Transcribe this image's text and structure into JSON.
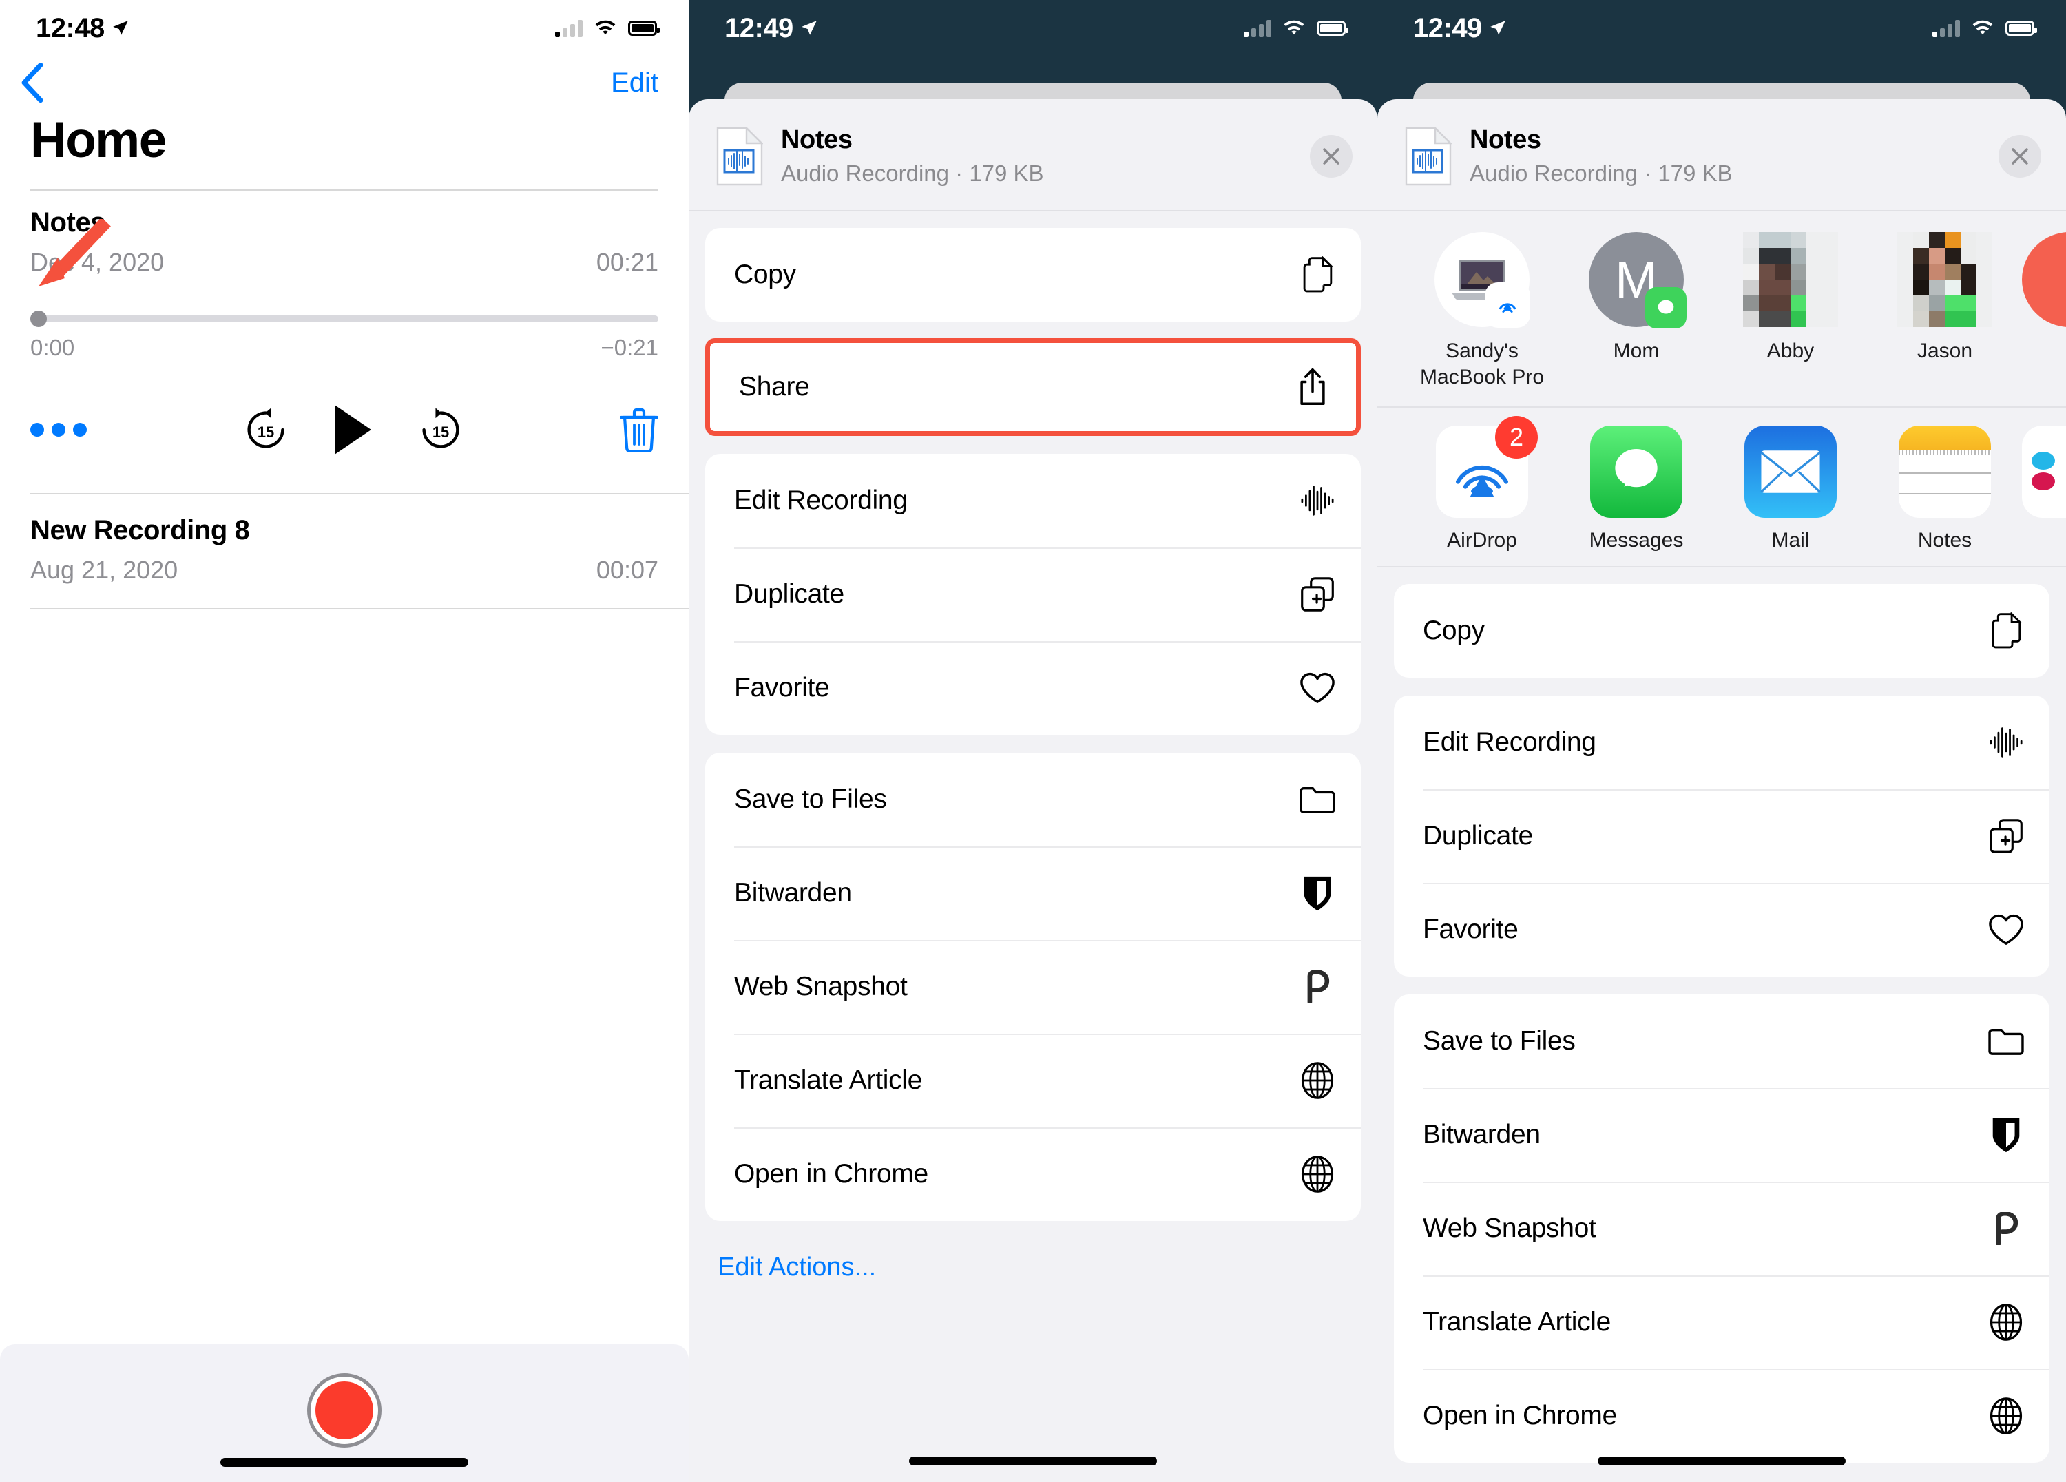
{
  "panel1": {
    "status": {
      "time": "12:48",
      "location_icon": "location-arrow-icon",
      "signal_icon": "cellular-signal-icon",
      "wifi_icon": "wifi-icon",
      "battery_icon": "battery-full-icon"
    },
    "nav": {
      "back_icon": "chevron-left-icon",
      "edit_label": "Edit"
    },
    "title": "Home",
    "recordings": [
      {
        "name": "Notes",
        "date": "Dec 4, 2020",
        "duration": "00:21",
        "expanded": true
      },
      {
        "name": "New Recording 8",
        "date": "Aug 21, 2020",
        "duration": "00:07",
        "expanded": false
      }
    ],
    "player": {
      "elapsed": "0:00",
      "remaining": "−0:21",
      "progress_percent": 0,
      "more_icon": "more-options-ellipsis-icon",
      "back15_icon": "skip-back-15-icon",
      "back15_label": "15",
      "play_icon": "play-icon",
      "forward15_icon": "skip-forward-15-icon",
      "forward15_label": "15",
      "delete_icon": "trash-icon"
    },
    "annotation": {
      "arrow_icon": "red-arrow-annotation",
      "color": "#f4513d"
    },
    "record_button": {
      "icon": "record-button",
      "color": "#fb3b2c"
    },
    "home_indicator": "home-indicator"
  },
  "panel2": {
    "status": {
      "time": "12:49",
      "location_icon": "location-arrow-icon",
      "signal_icon": "cellular-signal-icon",
      "wifi_icon": "wifi-icon",
      "battery_icon": "battery-full-icon"
    },
    "sheet_header": {
      "file_icon": "audio-waveform-document-icon",
      "title": "Notes",
      "subtitle": "Audio Recording · 179 KB",
      "close_icon": "close-x-icon"
    },
    "groups": [
      {
        "items": [
          {
            "label": "Copy",
            "icon": "copy-documents-icon"
          }
        ]
      },
      {
        "highlighted": true,
        "items": [
          {
            "label": "Share",
            "icon": "share-upload-icon"
          }
        ]
      },
      {
        "items": [
          {
            "label": "Edit Recording",
            "icon": "waveform-icon"
          },
          {
            "label": "Duplicate",
            "icon": "duplicate-plus-icon"
          },
          {
            "label": "Favorite",
            "icon": "heart-icon"
          }
        ]
      },
      {
        "items": [
          {
            "label": "Save to Files",
            "icon": "folder-icon"
          },
          {
            "label": "Bitwarden",
            "icon": "bitwarden-shield-icon"
          },
          {
            "label": "Web Snapshot",
            "icon": "web-snapshot-p-icon"
          },
          {
            "label": "Translate Article",
            "icon": "globe-icon"
          },
          {
            "label": "Open in Chrome",
            "icon": "globe-icon"
          }
        ]
      }
    ],
    "edit_actions_label": "Edit Actions...",
    "home_indicator": "home-indicator"
  },
  "panel3": {
    "status": {
      "time": "12:49",
      "location_icon": "location-arrow-icon",
      "signal_icon": "cellular-signal-icon",
      "wifi_icon": "wifi-icon",
      "battery_icon": "battery-full-icon"
    },
    "sheet_header": {
      "file_icon": "audio-waveform-document-icon",
      "title": "Notes",
      "subtitle": "Audio Recording · 179 KB",
      "close_icon": "close-x-icon"
    },
    "contacts": [
      {
        "name": "Sandy's MacBook Pro",
        "avatar_type": "macbook",
        "badge": "airdrop-badge-icon"
      },
      {
        "name": "Mom",
        "avatar_type": "initial",
        "initial": "M",
        "badge": "messages-badge-icon"
      },
      {
        "name": "Abby",
        "avatar_type": "photo-blurred",
        "badge": "messages-badge-icon"
      },
      {
        "name": "Jason",
        "avatar_type": "photo-blurred",
        "badge": "messages-badge-icon"
      },
      {
        "name": "",
        "avatar_type": "red-circle-partial",
        "badge": ""
      }
    ],
    "apps": [
      {
        "name": "AirDrop",
        "icon": "airdrop-icon",
        "badge": "2"
      },
      {
        "name": "Messages",
        "icon": "messages-icon",
        "badge": ""
      },
      {
        "name": "Mail",
        "icon": "mail-icon",
        "badge": ""
      },
      {
        "name": "Notes",
        "icon": "notes-icon",
        "badge": ""
      },
      {
        "name": "",
        "icon": "partial-app-icon",
        "badge": ""
      }
    ],
    "groups": [
      {
        "items": [
          {
            "label": "Copy",
            "icon": "copy-documents-icon"
          }
        ]
      },
      {
        "items": [
          {
            "label": "Edit Recording",
            "icon": "waveform-icon"
          },
          {
            "label": "Duplicate",
            "icon": "duplicate-plus-icon"
          },
          {
            "label": "Favorite",
            "icon": "heart-icon"
          }
        ]
      },
      {
        "items": [
          {
            "label": "Save to Files",
            "icon": "folder-icon"
          },
          {
            "label": "Bitwarden",
            "icon": "bitwarden-shield-icon"
          },
          {
            "label": "Web Snapshot",
            "icon": "web-snapshot-p-icon"
          },
          {
            "label": "Translate Article",
            "icon": "globe-icon"
          },
          {
            "label": "Open in Chrome",
            "icon": "globe-icon"
          }
        ]
      }
    ],
    "home_indicator": "home-indicator"
  },
  "colors": {
    "ios_blue": "#007aff",
    "highlight_red": "#f4513d",
    "record_red": "#fb3b2c",
    "sheet_bg": "#f2f2f5",
    "dark_bg": "#1b3442"
  }
}
